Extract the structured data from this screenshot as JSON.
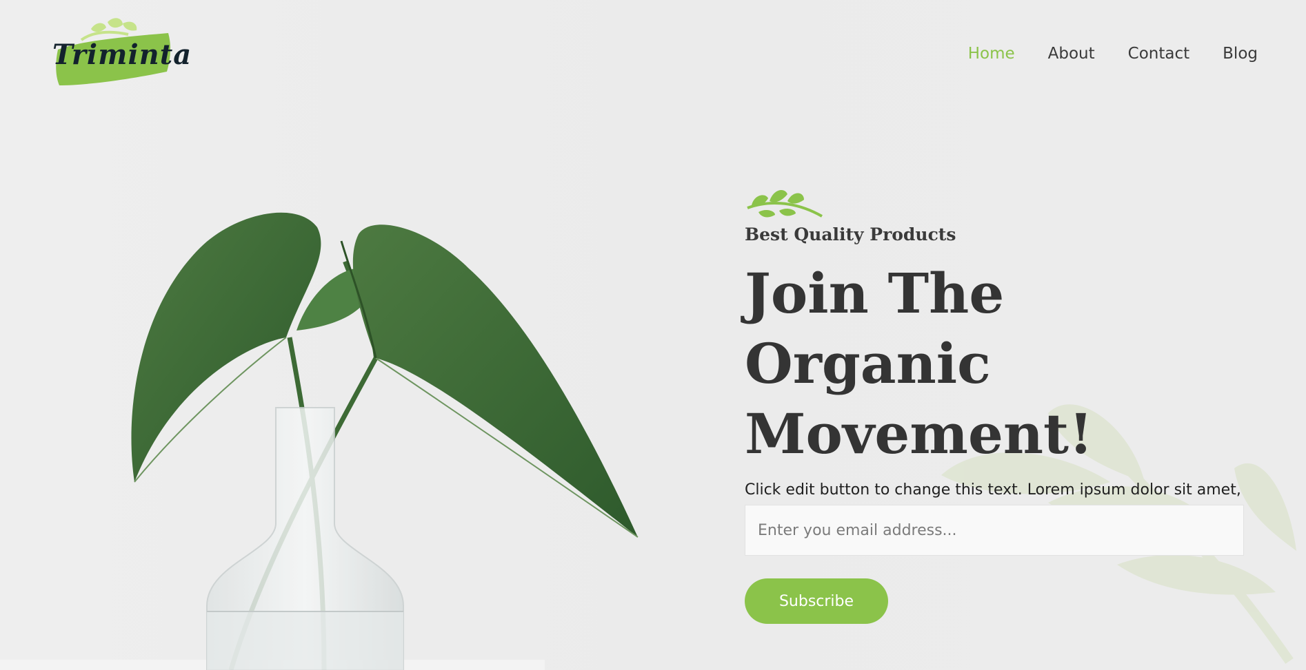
{
  "brand": {
    "name": "Triminta"
  },
  "nav": {
    "items": [
      {
        "label": "Home",
        "active": true
      },
      {
        "label": "About",
        "active": false
      },
      {
        "label": "Contact",
        "active": false
      },
      {
        "label": "Blog",
        "active": false
      }
    ]
  },
  "hero": {
    "eyebrow": "Best Quality Products",
    "headline_line1": "Join The Organic",
    "headline_line2": "Movement!",
    "description": "Click edit button to change this text. Lorem ipsum dolor sit amet, consectetur adipiscing elit. Sapien.",
    "email_placeholder": "Enter you email address...",
    "subscribe_label": "Subscribe"
  },
  "colors": {
    "accent": "#8bc34a",
    "background": "#ececec",
    "heading": "#343434",
    "leaf_dark": "#3f6b37"
  },
  "icons": {
    "logo_sprig": "leaf-sprig-icon",
    "hero_sprig": "leaf-sprig-icon",
    "watermark": "leaf-watermark-icon"
  }
}
